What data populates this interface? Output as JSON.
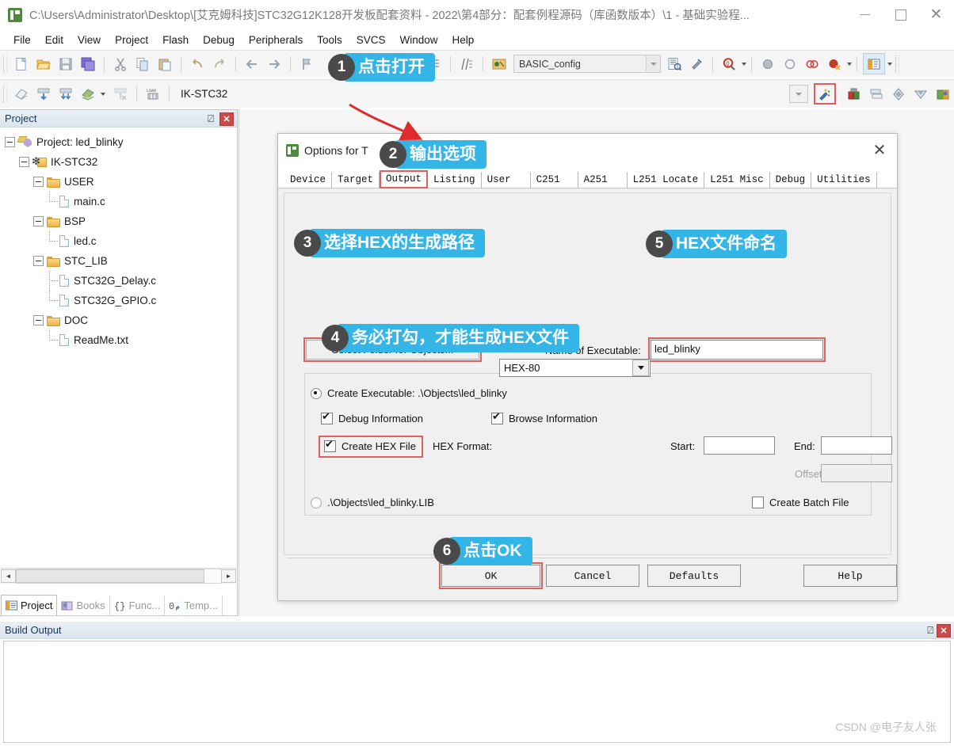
{
  "window": {
    "title": "C:\\Users\\Administrator\\Desktop\\[艾克姆科技]STC32G12K128开发板配套资料 - 2022\\第4部分：配套例程源码（库函数版本）\\1 - 基础实验程...",
    "app_icon": "keil-uvision-icon",
    "minimize": "—",
    "maximize": "□",
    "close": "✕"
  },
  "menubar": {
    "items": [
      {
        "label": "File"
      },
      {
        "label": "Edit"
      },
      {
        "label": "View"
      },
      {
        "label": "Project"
      },
      {
        "label": "Flash"
      },
      {
        "label": "Debug"
      },
      {
        "label": "Peripherals"
      },
      {
        "label": "Tools"
      },
      {
        "label": "SVCS"
      },
      {
        "label": "Window"
      },
      {
        "label": "Help"
      }
    ]
  },
  "toolbar_row1": {
    "buttons": [
      {
        "name": "new-file-icon"
      },
      {
        "name": "open-file-icon"
      },
      {
        "name": "save-icon"
      },
      {
        "name": "save-all-icon"
      },
      {
        "name": "cut-icon"
      },
      {
        "name": "copy-icon"
      },
      {
        "name": "paste-icon"
      },
      {
        "name": "undo-icon"
      },
      {
        "name": "redo-icon"
      },
      {
        "name": "back-icon"
      },
      {
        "name": "forward-icon"
      },
      {
        "name": "bookmark-icon"
      }
    ],
    "indent_icons": [
      "indent-icon",
      "outdent-icon"
    ],
    "config_combo": {
      "value": "BASIC_config",
      "name": "configuration-wizard-combo"
    },
    "right_icons": [
      "file-properties-icon",
      "configure-icon",
      "find-in-files-icon",
      "breakpoint-filled-icon",
      "breakpoint-empty-icon",
      "disable-breakpoints-icon",
      "kill-breakpoints-icon",
      "project-window-icon"
    ]
  },
  "toolbar_row2": {
    "buttons": [
      {
        "name": "translate-icon"
      },
      {
        "name": "build-icon"
      },
      {
        "name": "rebuild-icon"
      },
      {
        "name": "batch-build-icon"
      },
      {
        "name": "stop-build-icon"
      },
      {
        "name": "download-icon"
      }
    ],
    "target_combo": {
      "value": "IK-STC32",
      "name": "target-selector-combo"
    },
    "options_button": {
      "name": "options-for-target-icon"
    },
    "other_icons": [
      "manage-components-icon",
      "multi-project-icon",
      "pack-installer-icon",
      "manage-run-time-icon",
      "books-icon"
    ]
  },
  "project_panel": {
    "title": "Project",
    "pin": "⍁",
    "close": "✕",
    "tree": [
      {
        "label": "Project: led_blinky",
        "depth": 0,
        "icon": "project-icon",
        "expander": "minus"
      },
      {
        "label": "IK-STC32",
        "depth": 1,
        "icon": "target-icon",
        "expander": "minus"
      },
      {
        "label": "USER",
        "depth": 2,
        "icon": "folder-icon",
        "expander": "minus"
      },
      {
        "label": "main.c",
        "depth": 3,
        "icon": "file-icon",
        "expander": "none"
      },
      {
        "label": "BSP",
        "depth": 2,
        "icon": "folder-icon",
        "expander": "minus"
      },
      {
        "label": "led.c",
        "depth": 3,
        "icon": "file-icon",
        "expander": "none"
      },
      {
        "label": "STC_LIB",
        "depth": 2,
        "icon": "folder-icon",
        "expander": "minus"
      },
      {
        "label": "STC32G_Delay.c",
        "depth": 3,
        "icon": "file-icon",
        "expander": "none"
      },
      {
        "label": "STC32G_GPIO.c",
        "depth": 3,
        "icon": "file-icon",
        "expander": "none"
      },
      {
        "label": "DOC",
        "depth": 2,
        "icon": "folder-icon",
        "expander": "minus"
      },
      {
        "label": "ReadMe.txt",
        "depth": 3,
        "icon": "file-icon",
        "expander": "none"
      }
    ],
    "tabs": [
      {
        "label": "Project",
        "icon": "project-window-icon",
        "active": true
      },
      {
        "label": "Books",
        "icon": "books-icon",
        "active": false
      },
      {
        "label": "Func...",
        "icon": "functions-icon",
        "active": false
      },
      {
        "label": "Temp...",
        "icon": "templates-icon",
        "active": false
      }
    ],
    "scroll_left": "◄",
    "scroll_right": "►"
  },
  "build_output": {
    "title": "Build Output",
    "pin": "⍁",
    "close": "✕",
    "content": ""
  },
  "dialog": {
    "title": "Options for T",
    "close": "✕",
    "tabs": [
      {
        "label": "Device",
        "selected": false
      },
      {
        "label": "Target",
        "selected": false
      },
      {
        "label": "Output",
        "selected": true
      },
      {
        "label": "Listing",
        "selected": false
      },
      {
        "label": "User",
        "selected": false
      },
      {
        "label": "C251",
        "selected": false
      },
      {
        "label": "A251",
        "selected": false
      },
      {
        "label": "L251 Locate",
        "selected": false
      },
      {
        "label": "L251 Misc",
        "selected": false
      },
      {
        "label": "Debug",
        "selected": false
      },
      {
        "label": "Utilities",
        "selected": false
      }
    ],
    "select_folder_button": "Select Folder for Objects...",
    "name_of_executable_label": "Name of Executable:",
    "name_of_executable_value": "led_blinky",
    "create_executable_label": "Create Executable: .\\Objects\\led_blinky",
    "create_executable_checked": true,
    "debug_information_label": "Debug Information",
    "debug_information_checked": true,
    "browse_information_label": "Browse Information",
    "browse_information_checked": true,
    "create_hex_file_label": "Create HEX File",
    "create_hex_file_checked": true,
    "hex_format_label": "HEX Format:",
    "hex_format_value": "HEX-80",
    "start_label": "Start:",
    "start_value": "",
    "end_label": "End:",
    "end_value": "",
    "offset_label": "Offset:",
    "offset_value": "",
    "create_library_label": ".\\Objects\\led_blinky.LIB",
    "create_library_checked": false,
    "create_batch_file_label": "Create Batch File",
    "create_batch_file_checked": false,
    "buttons": {
      "ok": "OK",
      "cancel": "Cancel",
      "defaults": "Defaults",
      "help": "Help"
    }
  },
  "callouts": [
    {
      "num": "1",
      "text": "点击打开"
    },
    {
      "num": "2",
      "text": "输出选项"
    },
    {
      "num": "3",
      "text": "选择HEX的生成路径"
    },
    {
      "num": "4",
      "text": "务必打勾，才能生成HEX文件"
    },
    {
      "num": "5",
      "text": "HEX文件命名"
    },
    {
      "num": "6",
      "text": "点击OK"
    }
  ],
  "colors": {
    "callout_badge": "#4a4a4a",
    "callout_banner": "#33b5e8",
    "highlight_box": "#e06060",
    "arrow": "#e02b2b"
  },
  "watermark": "CSDN @电子友人张"
}
